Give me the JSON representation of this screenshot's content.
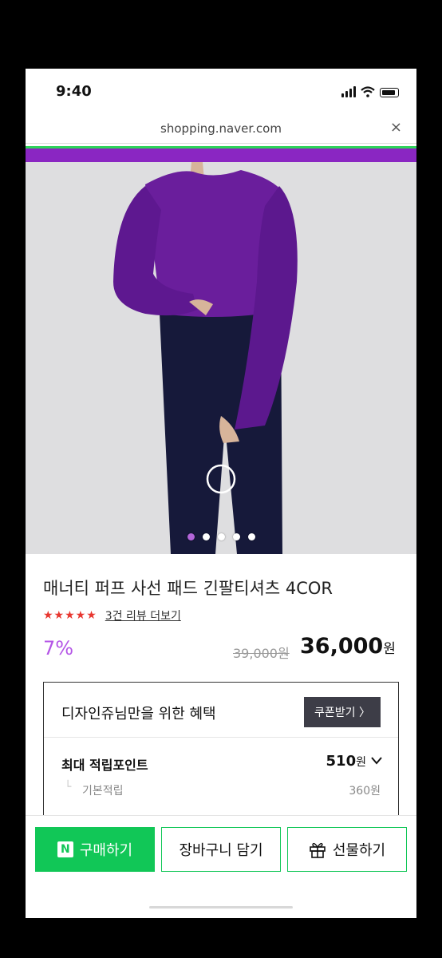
{
  "status": {
    "time": "9:40"
  },
  "browser": {
    "url": "shopping.naver.com",
    "close_glyph": "×"
  },
  "carousel": {
    "dot_count": 5,
    "active_index": 0
  },
  "product": {
    "title": "매너티 퍼프 사선 패드 긴팔티셔츠 4COR",
    "stars": "★★★★★",
    "review_link": "3건 리뷰 더보기",
    "discount": "7%",
    "original_price": "39,000원",
    "price": "36,000",
    "price_unit": "원"
  },
  "benefit": {
    "title": "디자인쥬님만을 위한 혜택",
    "coupon_button": "쿠폰받기 〉",
    "points_label": "최대 적립포인트",
    "points_value": "510",
    "points_unit": "원",
    "base_label": "기본적립",
    "base_value": "360원"
  },
  "actions": {
    "buy": "구매하기",
    "buy_logo": "N",
    "cart": "장바구니 담기",
    "gift": "선물하기"
  },
  "colors": {
    "accent_green": "#11c757",
    "accent_purple": "#b455e6",
    "star_red": "#e8362f"
  }
}
